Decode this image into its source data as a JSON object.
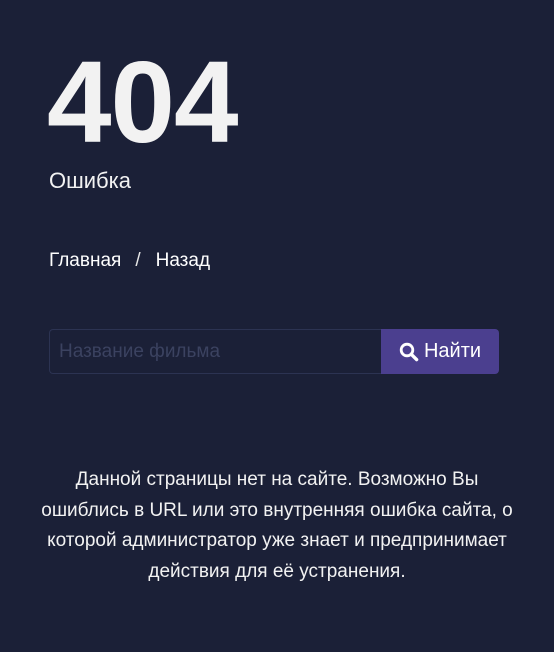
{
  "error": {
    "code": "404",
    "label": "Ошибка"
  },
  "nav": {
    "home_label": "Главная",
    "separator": "/",
    "back_label": "Назад"
  },
  "search": {
    "placeholder": "Название фильма",
    "value": "",
    "button_label": "Найти",
    "button_icon": "search-icon"
  },
  "message": {
    "text": "Данной страницы нет на сайте. Возможно Вы ошиблись в URL или это внутренняя ошибка сайта, о которой администратор уже знает и предпринимает действия для её устранения."
  },
  "colors": {
    "background": "#1b2037",
    "accent": "#4b3f8f",
    "text": "#f2f2f2"
  }
}
